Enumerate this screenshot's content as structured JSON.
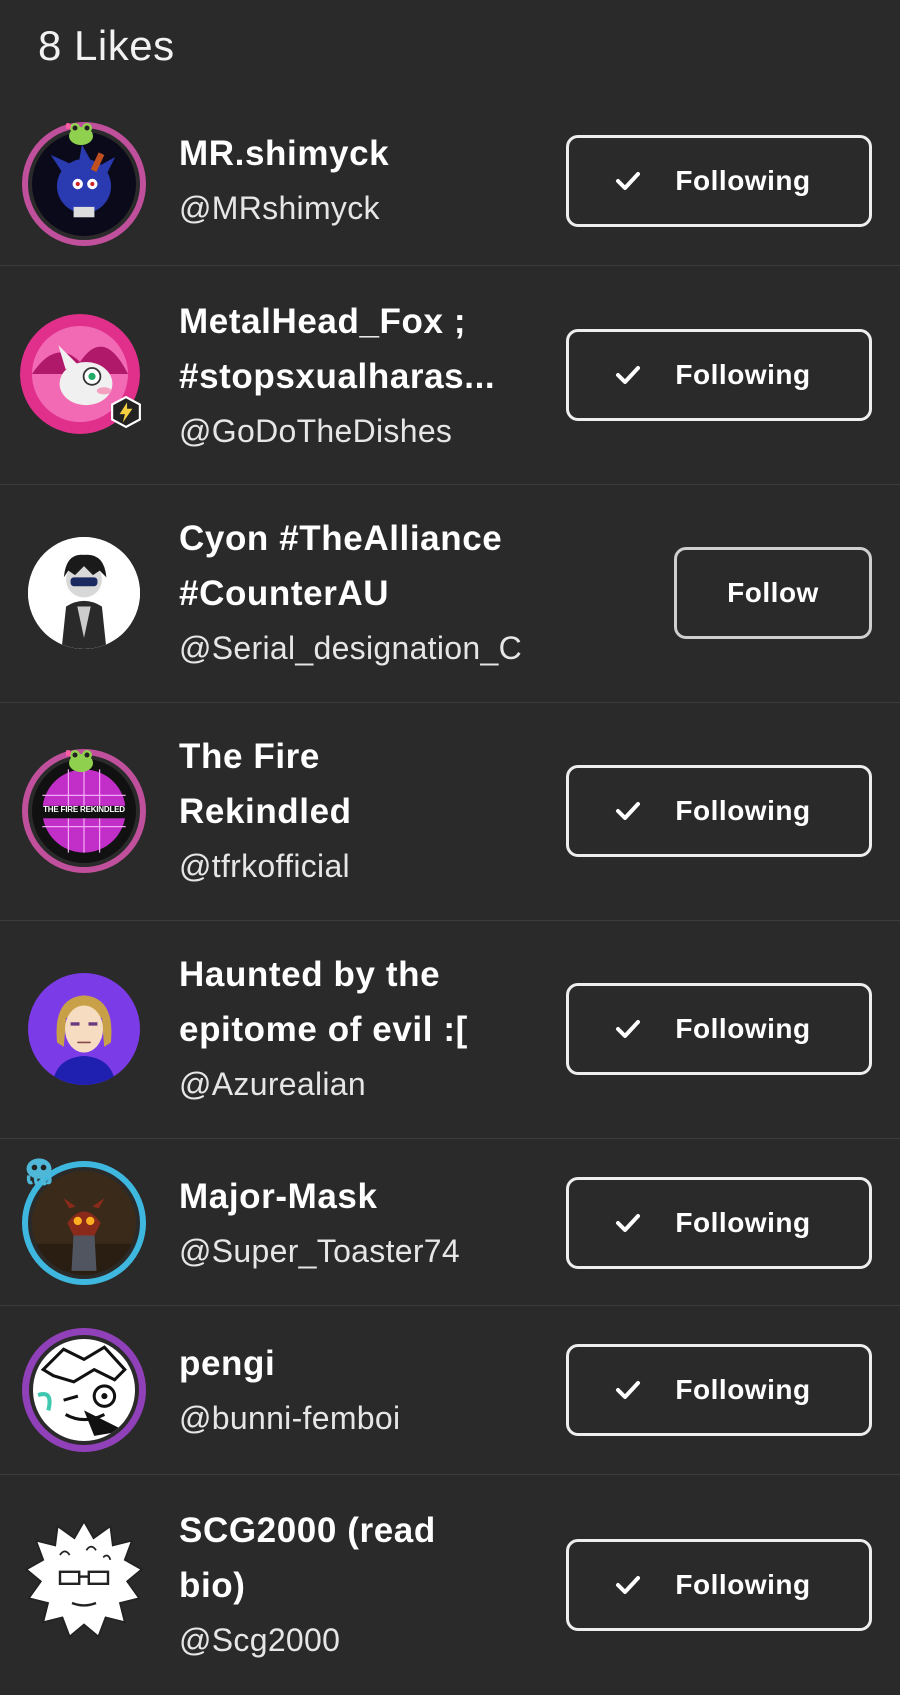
{
  "header": {
    "title": "8 Likes"
  },
  "users": [
    {
      "name_lines": [
        "MR.shimyck"
      ],
      "handle": "@MRshimyck",
      "button": "Following",
      "following": true,
      "avatar_icon": "avatar-blue-hedgehog",
      "ring_color": "#c0509c"
    },
    {
      "name_lines": [
        "MetalHead_Fox ;",
        "#stopsxualharas..."
      ],
      "handle": "@GoDoTheDishes",
      "button": "Following",
      "following": true,
      "avatar_icon": "avatar-pink-fox",
      "ring_color": "#e03aa0"
    },
    {
      "name_lines": [
        "Cyon #TheAlliance",
        "#CounterAU"
      ],
      "handle": "@Serial_designation_C",
      "button": "Follow",
      "following": false,
      "avatar_icon": "avatar-dark-figure",
      "ring_color": "#ffffff"
    },
    {
      "name_lines": [
        "The Fire",
        "Rekindled"
      ],
      "handle": "@tfrkofficial",
      "button": "Following",
      "following": true,
      "avatar_icon": "avatar-disco-ball",
      "ring_color": "#c0509c",
      "avatar_text": "THE FIRE REKINDLED"
    },
    {
      "name_lines": [
        "Haunted by the",
        "epitome of evil :["
      ],
      "handle": "@Azurealian",
      "button": "Following",
      "following": true,
      "avatar_icon": "avatar-cartoon-woman",
      "ring_color": "#7b3ce8"
    },
    {
      "name_lines": [
        "Major-Mask"
      ],
      "handle": "@Super_Toaster74",
      "button": "Following",
      "following": true,
      "avatar_icon": "avatar-masked-figure",
      "ring_color": "#3fb8e0"
    },
    {
      "name_lines": [
        "pengi"
      ],
      "handle": "@bunni-femboi",
      "button": "Following",
      "following": true,
      "avatar_icon": "avatar-sketch-face",
      "ring_color": "#9040b8"
    },
    {
      "name_lines": [
        "SCG2000 (read",
        "bio)"
      ],
      "handle": "@Scg2000",
      "button": "Following",
      "following": true,
      "avatar_icon": "avatar-spiky-sketch",
      "ring_color": "#ffffff"
    }
  ]
}
